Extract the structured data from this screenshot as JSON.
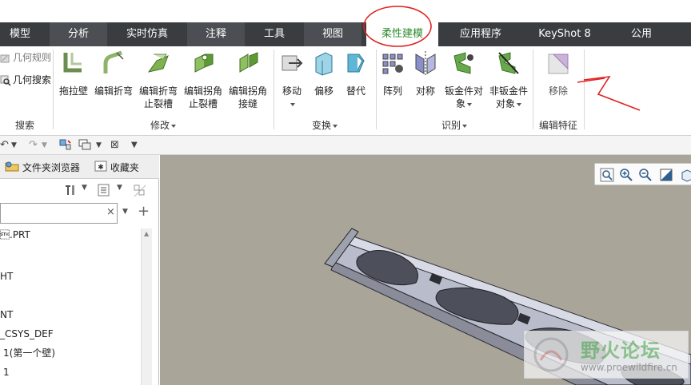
{
  "tabs": [
    {
      "label": "模型",
      "state": "normal"
    },
    {
      "label": "分析",
      "state": "alt"
    },
    {
      "label": "实时仿真",
      "state": "normal"
    },
    {
      "label": "注释",
      "state": "alt"
    },
    {
      "label": "工具",
      "state": "normal"
    },
    {
      "label": "视图",
      "state": "alt"
    },
    {
      "label": "柔性建模",
      "state": "active"
    },
    {
      "label": "应用程序",
      "state": "normal"
    },
    {
      "label": "KeyShot 8",
      "state": "normal"
    },
    {
      "label": "公用",
      "state": "normal"
    }
  ],
  "ribbon": {
    "search_group": {
      "items": [
        "几何规则",
        "几何搜索"
      ],
      "label": "搜索"
    },
    "modify_group": {
      "buttons": [
        {
          "line1": "拖拉壁",
          "line2": ""
        },
        {
          "line1": "编辑折弯",
          "line2": ""
        },
        {
          "line1": "编辑折弯",
          "line2": "止裂槽"
        },
        {
          "line1": "编辑拐角",
          "line2": "止裂槽"
        },
        {
          "line1": "编辑拐角",
          "line2": "接缝"
        }
      ],
      "label": "修改"
    },
    "transform_group": {
      "buttons": [
        {
          "line1": "移动",
          "line2": ""
        },
        {
          "line1": "偏移",
          "line2": ""
        },
        {
          "line1": "替代",
          "line2": ""
        }
      ],
      "label": "变换"
    },
    "identify_group": {
      "buttons": [
        {
          "line1": "阵列",
          "line2": ""
        },
        {
          "line1": "对称",
          "line2": ""
        },
        {
          "line1": "钣金件对",
          "line2": "象"
        },
        {
          "line1": "非钣金件",
          "line2": "对象"
        }
      ],
      "label": "识别"
    },
    "edit_group": {
      "buttons": [
        {
          "line1": "移除",
          "line2": ""
        }
      ],
      "label": "编辑特征"
    }
  },
  "left_panel": {
    "tabs": [
      "文件夹浏览器",
      "收藏夹"
    ],
    "search_value": "",
    "tree": [
      "\u0002.PRT",
      "HT",
      "NT",
      "_CSYS_DEF",
      "1(第一个壁)",
      "1"
    ]
  },
  "watermark": {
    "text": "野火论坛",
    "url": "www.proewildfire.cn"
  },
  "colors": {
    "tabbar_bg": "#3a3d40",
    "tabbar_alt": "#4b4f53",
    "active_tab_text": "#2d8a2d",
    "viewport_bg": "#a9a598",
    "annotation_red": "#e02020"
  }
}
